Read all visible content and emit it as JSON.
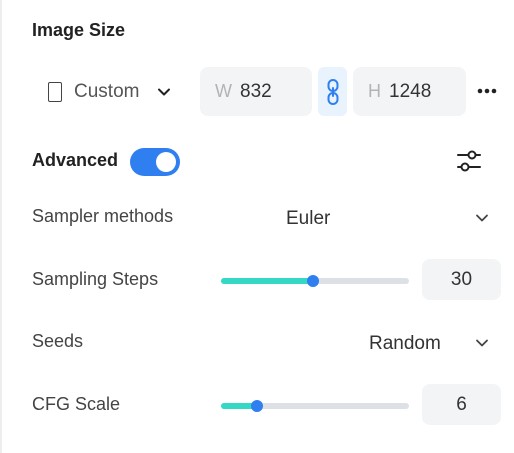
{
  "image_size": {
    "title": "Image Size",
    "ratio": {
      "icon": "portrait-rect-icon",
      "label": "Custom"
    },
    "width": {
      "prefix": "W",
      "value": "832"
    },
    "height": {
      "prefix": "H",
      "value": "1248"
    },
    "link_icon": "chain-link-icon",
    "more_icon": "more-horizontal-icon"
  },
  "advanced": {
    "label": "Advanced",
    "enabled": true,
    "toggle_color": "#2f7ff0",
    "settings_icon": "sliders-icon"
  },
  "sampler": {
    "label": "Sampler methods",
    "value": "Euler"
  },
  "steps": {
    "label": "Sampling Steps",
    "value": "30",
    "fill_fraction": 0.49
  },
  "seeds": {
    "label": "Seeds",
    "value": "Random"
  },
  "cfg": {
    "label": "CFG Scale",
    "value": "6",
    "fill_fraction": 0.19
  },
  "colors": {
    "accent": "#2f7ff0",
    "slider_fill": "#34d8c4",
    "track": "#dde1e6",
    "input_bg": "#f3f4f6"
  }
}
